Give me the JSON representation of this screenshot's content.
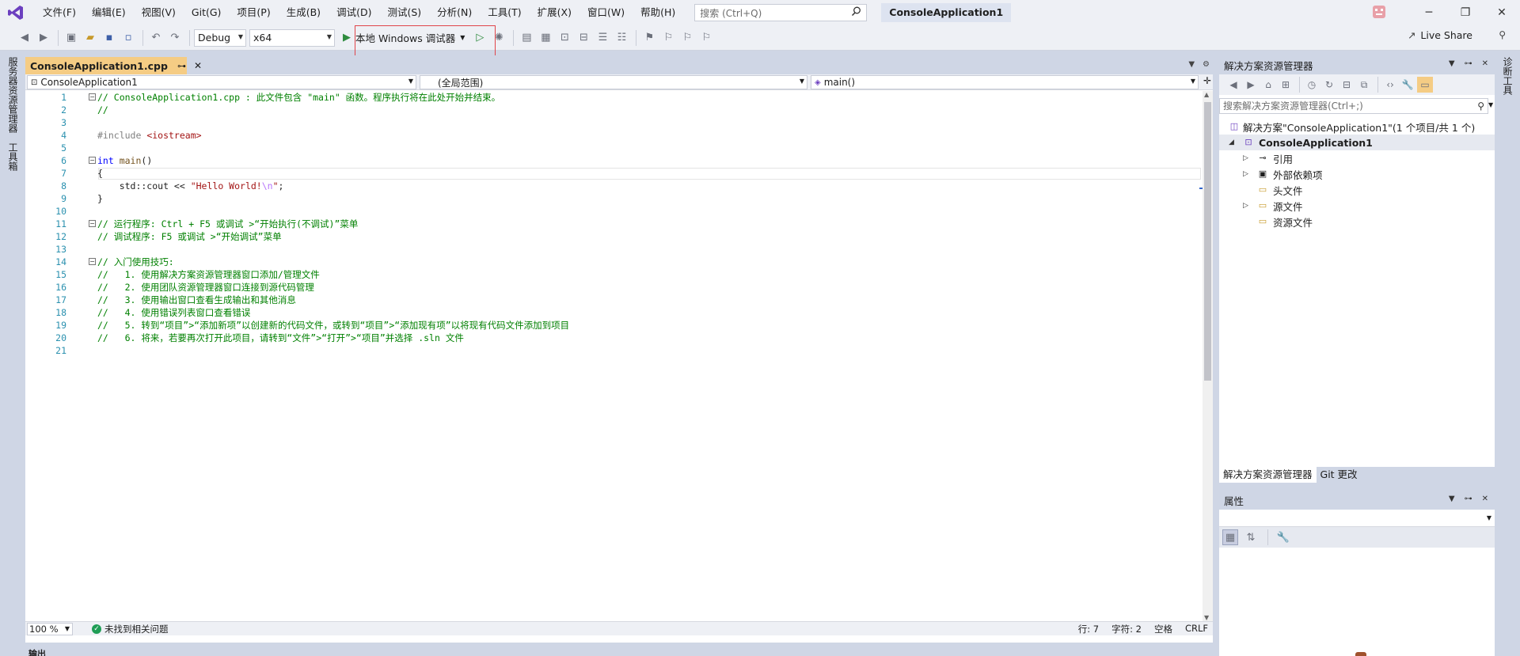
{
  "titlebar": {
    "menus": [
      "文件(F)",
      "编辑(E)",
      "视图(V)",
      "Git(G)",
      "项目(P)",
      "生成(B)",
      "调试(D)",
      "测试(S)",
      "分析(N)",
      "工具(T)",
      "扩展(X)",
      "窗口(W)",
      "帮助(H)"
    ],
    "search_placeholder": "搜索 (Ctrl+Q)",
    "solution_name": "ConsoleApplication1"
  },
  "toolbar": {
    "config": "Debug",
    "platform": "x64",
    "run_label": "本地 Windows 调试器",
    "live_share": "Live Share"
  },
  "left_strip": {
    "tab1": "服务器资源管理器",
    "tab2": "工具箱"
  },
  "right_strip": {
    "tab1": "诊断工具"
  },
  "editor": {
    "tab_name": "ConsoleApplication1.cpp",
    "nav_project": "ConsoleApplication1",
    "nav_scope": "(全局范围)",
    "nav_member": "main()",
    "line_numbers": [
      "1",
      "2",
      "3",
      "4",
      "5",
      "6",
      "7",
      "8",
      "9",
      "10",
      "11",
      "12",
      "13",
      "14",
      "15",
      "16",
      "17",
      "18",
      "19",
      "20",
      "21"
    ],
    "lines": {
      "l1": "// ConsoleApplication1.cpp : 此文件包含 \"main\" 函数。程序执行将在此处开始并结束。",
      "l2": "//",
      "l4a": "#include ",
      "l4b": "<iostream>",
      "l6a": "int",
      "l6b": " main",
      "l6c": "()",
      "l7": "{",
      "l8a": "    std::cout << ",
      "l8b": "\"Hello World!",
      "l8c": "\\n",
      "l8d": "\"",
      "l8e": ";",
      "l9": "}",
      "l11": "// 运行程序: Ctrl + F5 或调试 >“开始执行(不调试)”菜单",
      "l12": "// 调试程序: F5 或调试 >“开始调试”菜单",
      "l14": "// 入门使用技巧:",
      "l15": "//   1. 使用解决方案资源管理器窗口添加/管理文件",
      "l16": "//   2. 使用团队资源管理器窗口连接到源代码管理",
      "l17": "//   3. 使用输出窗口查看生成输出和其他消息",
      "l18": "//   4. 使用错误列表窗口查看错误",
      "l19": "//   5. 转到“项目”>“添加新项”以创建新的代码文件，或转到“项目”>“添加现有项”以将现有代码文件添加到项目",
      "l20": "//   6. 将来，若要再次打开此项目，请转到“文件”>“打开”>“项目”并选择 .sln 文件"
    },
    "status": {
      "zoom": "100 %",
      "issues": "未找到相关问题",
      "line": "行: 7",
      "char": "字符: 2",
      "spaces": "空格",
      "eol": "CRLF"
    }
  },
  "output": {
    "label": "输出"
  },
  "solution_explorer": {
    "title": "解决方案资源管理器",
    "search_placeholder": "搜索解决方案资源管理器(Ctrl+;)",
    "solution_row": "解决方案\"ConsoleApplication1\"(1 个项目/共 1 个)",
    "project": "ConsoleApplication1",
    "nodes": [
      "引用",
      "外部依赖项",
      "头文件",
      "源文件",
      "资源文件"
    ],
    "tabs": [
      "解决方案资源管理器",
      "Git 更改"
    ]
  },
  "properties": {
    "title": "属性"
  },
  "colors": {
    "accent_tab": "#f5cc84",
    "chrome": "#cfd6e5",
    "comment": "#008000",
    "keyword": "#0000ff",
    "string": "#a31515",
    "line_number": "#2b91af",
    "run_highlight": "#e0454a"
  },
  "icons": [
    "vs-logo-icon",
    "search-icon",
    "bug-icon",
    "play-icon",
    "save-icon",
    "undo-icon",
    "redo-icon",
    "pin-icon",
    "close-icon",
    "home-icon",
    "refresh-icon",
    "wrench-icon",
    "check-icon"
  ]
}
